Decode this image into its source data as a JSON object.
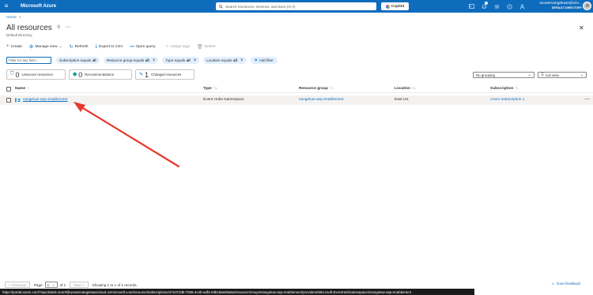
{
  "topbar": {
    "brand": "Microsoft Azure",
    "search_placeholder": "Search resources, services, and docs (G+/)",
    "copilot_label": "Copilot",
    "notification_count": "1",
    "user_email": "woutervangeluwe@iclo...",
    "user_directory": "DEFAULT DIRECTORY"
  },
  "breadcrumb": {
    "home": "Home",
    "separator": ">"
  },
  "page": {
    "title": "All resources",
    "subtitle": "Default Directory"
  },
  "toolbar": {
    "create": "Create",
    "manage_view": "Manage view",
    "refresh": "Refresh",
    "export_csv": "Export to CSV",
    "open_query": "Open query",
    "assign_tags": "Assign tags",
    "delete": "Delete"
  },
  "filters": {
    "placeholder": "Filter for any field...",
    "subscription": {
      "label": "Subscription equals",
      "value": "all"
    },
    "resource_group": {
      "label": "Resource group equals",
      "value": "all"
    },
    "type": {
      "label": "Type equals",
      "value": "all"
    },
    "location": {
      "label": "Location equals",
      "value": "all"
    },
    "add_filter": "Add filter"
  },
  "cards": [
    {
      "num": "0",
      "label": "Unsecure resources"
    },
    {
      "num": "0",
      "label": "Recommendations"
    },
    {
      "num": "1",
      "label": "Changed resources"
    }
  ],
  "grouping": "No grouping",
  "view": "List view",
  "table": {
    "columns": [
      "Name",
      "Type",
      "Resource group",
      "Location",
      "Subscription"
    ],
    "sort_glyph": "↑↓",
    "name_sort": "↑",
    "rows": [
      {
        "name": "vangeluw-aep-enablement",
        "type": "Event Hubs Namespace",
        "resource_group": "vangeluw-aep-enablement",
        "location": "East US",
        "subscription": "Azure subscription 1"
      }
    ]
  },
  "pager": {
    "previous": "< Previous",
    "page_label": "Page",
    "page_value": "1",
    "of_label": "of 1",
    "next": "Next >",
    "summary": "Showing 1 to 1 of 1 records."
  },
  "feedback": "Give feedback",
  "status_url": "https://portal.azure.com/?quickstart=true#@woutervangeluweicloud.onmicrosoft.com/resource/subscriptions/47e372d6-7936-4c4b-adf3-e9b156e83a6a/resourceGroups/vangeluw-aep-enablement/providers/Microsoft.EventHub/namespaces/vangeluw-aep-enablement",
  "colors": {
    "accent": "#0f6cbd",
    "annotation": "#e8372c"
  }
}
